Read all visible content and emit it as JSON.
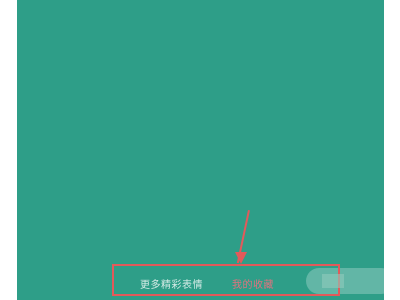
{
  "app": {
    "background_color": "#2e9e88",
    "accent_color": "#e25a5a"
  },
  "footer": {
    "left_link_label": "更多精彩表情",
    "right_link_label": "我的收藏",
    "right_item_label": ""
  },
  "annotation": {
    "highlight_color": "#e25a5a"
  }
}
